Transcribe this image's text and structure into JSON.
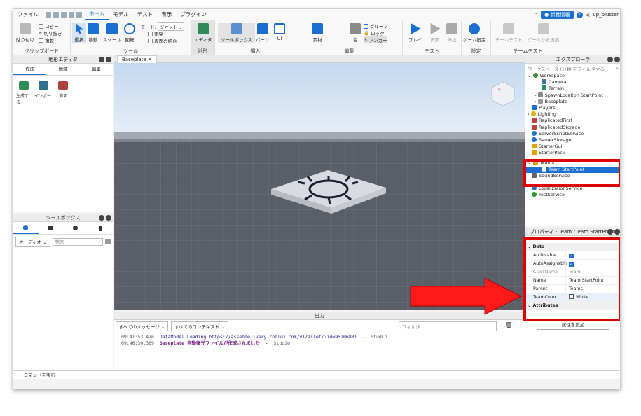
{
  "menubar": {
    "items": [
      "ファイル",
      "ホーム",
      "モデル",
      "テスト",
      "表示",
      "プラグイン"
    ],
    "active": "ホーム",
    "news_label": "新着情報",
    "username": "up_bluster"
  },
  "ribbon": {
    "clipboard": {
      "paste": "貼り付け",
      "copy": "コピー",
      "cut": "切り抜き",
      "duplicate": "複製",
      "label": "クリップボード"
    },
    "tools": {
      "select": "選択",
      "move": "移動",
      "scale": "スケール",
      "rotate": "回転",
      "mode_label": "モード:",
      "mode_value": "ジオメトリ",
      "collisions": "衝突",
      "join": "表面の結合",
      "label": "ツール"
    },
    "terrain": {
      "editor": "エディタ",
      "label": "地形"
    },
    "insert": {
      "toolbox": "ツールボックス",
      "part": "パーツ",
      "ui": "UI",
      "label": "挿入"
    },
    "edit": {
      "material": "素材",
      "color": "色",
      "group": "グループ",
      "lock": "ロック",
      "anchor": "アンカー",
      "label": "編集"
    },
    "test": {
      "play": "プレイ",
      "resume": "再開",
      "stop": "停止",
      "label": "テスト"
    },
    "settings": {
      "game_settings": "ゲーム設定",
      "label": "設定"
    },
    "team_test": {
      "team_test": "チームテスト",
      "exit_game": "ゲームから退出",
      "label": "チームテスト"
    }
  },
  "terrain_editor": {
    "title": "地形エディタ",
    "tabs": [
      "作成",
      "地域",
      "編集"
    ],
    "buttons": [
      "生成する",
      "インポート",
      "消す"
    ]
  },
  "toolbox": {
    "title": "ツールボックス",
    "filter": "オーディオ",
    "search_placeholder": "検索"
  },
  "viewport": {
    "tab": "Baseplate"
  },
  "output": {
    "title": "出力",
    "filter_messages": "すべてのメッセージ",
    "filter_contexts": "すべてのコンテキスト",
    "filter_placeholder": "フィルタ...",
    "logs": [
      {
        "time": "09:41:53.426",
        "text": "DataModel Loading https://assetdelivery.roblox.com/v1/asset/?id=95206881",
        "source": "Studio"
      },
      {
        "time": "09:46:30.389",
        "text": "Baseplate 自動復元ファイルが作成されました",
        "source": "Studio"
      }
    ]
  },
  "explorer": {
    "title": "エクスプローラ",
    "search_placeholder": "ワークスペース (分類)をフィルタする",
    "items": [
      {
        "label": "Workspace",
        "color": "#3a8a3a"
      },
      {
        "label": "Camera",
        "color": "#4a6fa5"
      },
      {
        "label": "Terrain",
        "color": "#2e8b57"
      },
      {
        "label": "SpawnLocation StartPoint",
        "color": "#888888"
      },
      {
        "label": "Baseplate",
        "color": "#999999"
      },
      {
        "label": "Players",
        "color": "#1a6fd1"
      },
      {
        "label": "Lighting",
        "color": "#e0b000"
      },
      {
        "label": "ReplicatedFirst",
        "color": "#c04040"
      },
      {
        "label": "ReplicatedStorage",
        "color": "#c04040"
      },
      {
        "label": "ServerScriptService",
        "color": "#1a6fd1"
      },
      {
        "label": "ServerStorage",
        "color": "#1a6fd1"
      },
      {
        "label": "StarterGui",
        "color": "#e0a000"
      },
      {
        "label": "StarterPack",
        "color": "#e0a000"
      },
      {
        "label": "Teams",
        "color": "#e0a000"
      },
      {
        "label": "Team StartPoint",
        "color": "#ffffff"
      },
      {
        "label": "SoundService",
        "color": "#666666"
      },
      {
        "label": "LocalizationService",
        "color": "#1a6fd1"
      },
      {
        "label": "TestService",
        "color": "#2a9a2a"
      }
    ]
  },
  "properties": {
    "title": "プロパティ - Team \"Team StartPoint\"",
    "section_data": "Data",
    "rows": [
      {
        "key": "Archivable",
        "value": "",
        "checkbox": true
      },
      {
        "key": "AutoAssignable",
        "value": "",
        "checkbox": true
      },
      {
        "key": "ClassName",
        "value": "Team",
        "checkbox": false
      },
      {
        "key": "Name",
        "value": "Team StartPoint",
        "checkbox": false
      },
      {
        "key": "Parent",
        "value": "Teams",
        "checkbox": false
      },
      {
        "key": "TeamColor",
        "value": "White",
        "checkbox": false
      }
    ],
    "section_attributes": "Attributes",
    "add_attribute": "属性を追加"
  },
  "command_bar": {
    "placeholder": "コマンドを実行"
  }
}
